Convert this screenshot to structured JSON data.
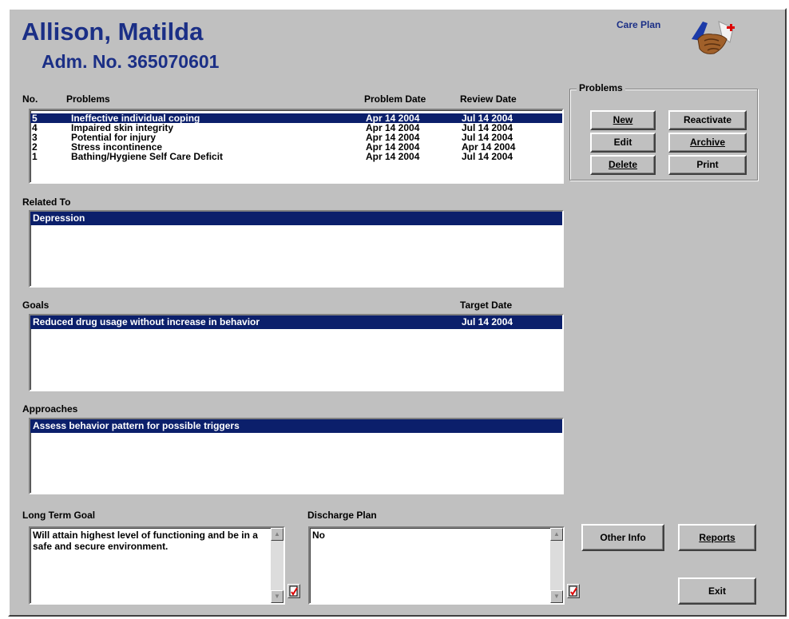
{
  "patient": {
    "name": "Allison, Matilda",
    "adm": "Adm. No. 365070601"
  },
  "module_title": "Care Plan",
  "logo_icon": "handshake-icon",
  "problems_headers": {
    "no": "No.",
    "problem": "Problems",
    "problem_date": "Problem Date",
    "review_date": "Review Date"
  },
  "problems": [
    {
      "no": "5",
      "problem": "Ineffective individual coping",
      "problem_date": "Apr 14 2004",
      "review_date": "Jul 14 2004",
      "selected": true
    },
    {
      "no": "4",
      "problem": "Impaired skin integrity",
      "problem_date": "Apr 14 2004",
      "review_date": "Jul 14 2004"
    },
    {
      "no": "3",
      "problem": "Potential for injury",
      "problem_date": "Apr 14 2004",
      "review_date": "Jul 14 2004"
    },
    {
      "no": "2",
      "problem": "Stress incontinence",
      "problem_date": "Apr 14 2004",
      "review_date": "Apr 14 2004"
    },
    {
      "no": "1",
      "problem": "Bathing/Hygiene Self Care Deficit",
      "problem_date": "Apr 14 2004",
      "review_date": "Jul 14 2004"
    }
  ],
  "problems_group": {
    "title": "Problems",
    "new": "New",
    "reactivate": "Reactivate",
    "edit": "Edit",
    "archive": "Archive",
    "delete": "Delete",
    "print": "Print"
  },
  "related_to": {
    "label": "Related To",
    "items": [
      "Depression"
    ]
  },
  "goals": {
    "label": "Goals",
    "target_label": "Target Date",
    "items": [
      {
        "text": "Reduced drug usage without increase in behavior",
        "target": "Jul 14 2004"
      }
    ]
  },
  "approaches": {
    "label": "Approaches",
    "items": [
      "Assess behavior pattern for possible triggers"
    ]
  },
  "long_term_goal": {
    "label": "Long Term Goal",
    "text": "Will attain highest level of functioning and be in a safe and secure environment."
  },
  "discharge_plan": {
    "label": "Discharge Plan",
    "text": "No"
  },
  "buttons": {
    "other_info": "Other Info",
    "reports": "Reports",
    "exit": "Exit"
  },
  "colors": {
    "selection": "#0b1f6b",
    "title": "#1b2f86",
    "window": "#c0c0c0"
  }
}
